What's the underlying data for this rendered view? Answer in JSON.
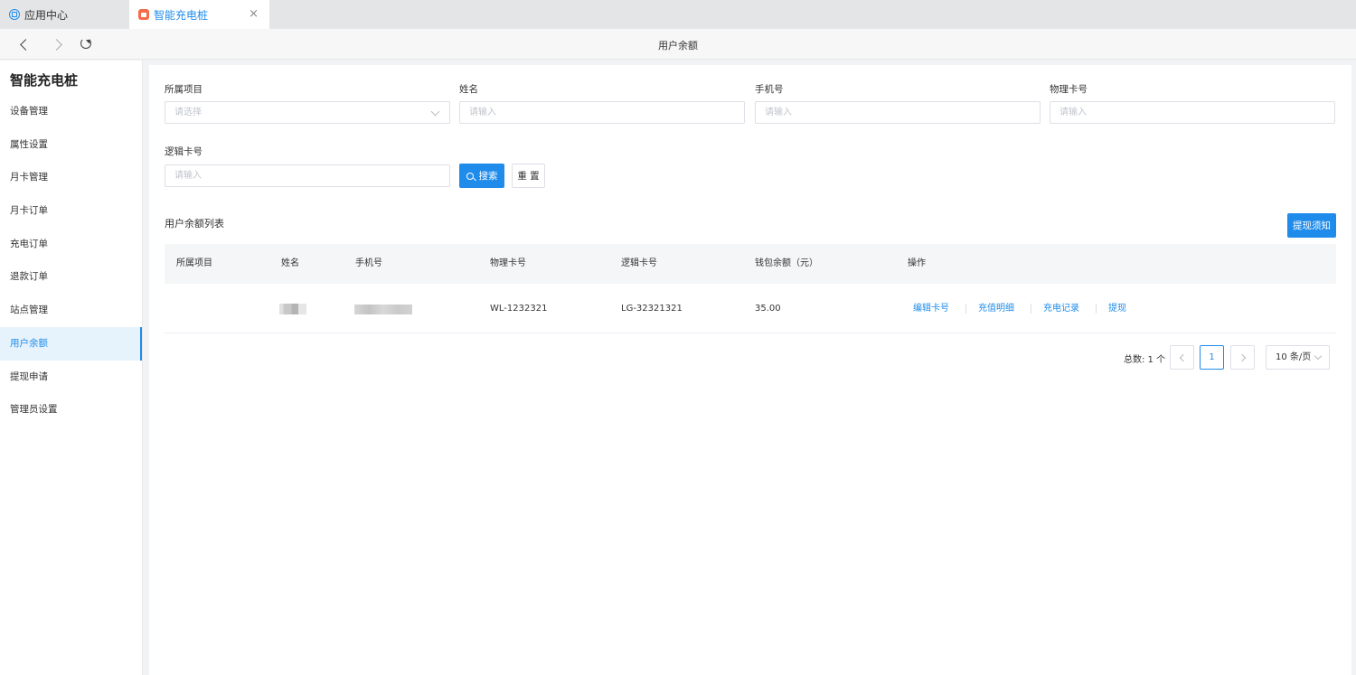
{
  "tabs": [
    {
      "label": "应用中心",
      "icon": "app-center-icon"
    },
    {
      "label": "智能充电桩",
      "icon": "charging-pile-icon",
      "active": true
    }
  ],
  "nav": {
    "title": "用户余额"
  },
  "sidebar": {
    "title": "智能充电桩",
    "items": [
      {
        "label": "设备管理"
      },
      {
        "label": "属性设置"
      },
      {
        "label": "月卡管理"
      },
      {
        "label": "月卡订单"
      },
      {
        "label": "充电订单"
      },
      {
        "label": "退款订单"
      },
      {
        "label": "站点管理"
      },
      {
        "label": "用户余额",
        "active": true
      },
      {
        "label": "提现申请"
      },
      {
        "label": "管理员设置"
      }
    ]
  },
  "filters": {
    "project": {
      "label": "所属项目",
      "placeholder": "请选择"
    },
    "name": {
      "label": "姓名",
      "placeholder": "请输入"
    },
    "phone": {
      "label": "手机号",
      "placeholder": "请输入"
    },
    "physical_card": {
      "label": "物理卡号",
      "placeholder": "请输入"
    },
    "logical_card": {
      "label": "逻辑卡号",
      "placeholder": "请输入"
    },
    "search_label": "搜索",
    "reset_label": "重 置"
  },
  "list": {
    "title": "用户余额列表",
    "notice_button": "提现须知",
    "columns": [
      "所属项目",
      "姓名",
      "手机号",
      "物理卡号",
      "逻辑卡号",
      "钱包余额（元）",
      "操作"
    ],
    "rows": [
      {
        "project": "",
        "physical_card": "WL-1232321",
        "logical_card": "LG-32321321",
        "balance": "35.00",
        "actions": [
          "编辑卡号",
          "充值明细",
          "充电记录",
          "提现"
        ]
      }
    ]
  },
  "pagination": {
    "total": "总数: 1 个",
    "current_page": "1",
    "page_size": "10 条/页"
  },
  "colors": {
    "accent": "#1f8ceb"
  }
}
